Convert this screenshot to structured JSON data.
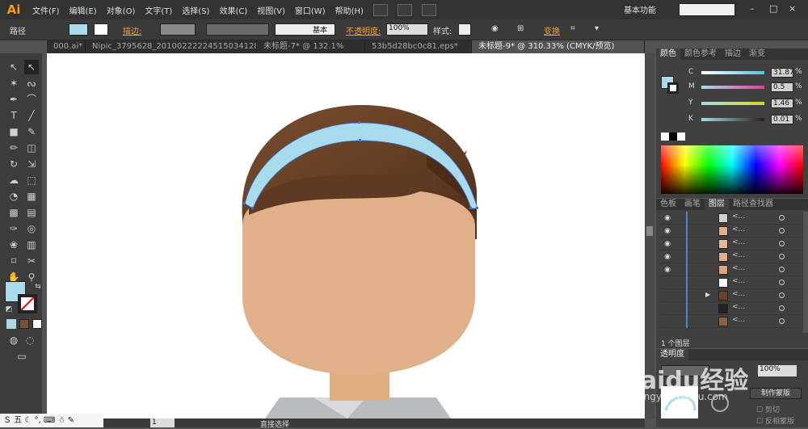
{
  "app": {
    "logo": "Ai",
    "workspace": "基本功能",
    "minimize": "–",
    "restore": "□",
    "close": "×"
  },
  "menu": [
    "文件(F)",
    "编辑(E)",
    "对象(O)",
    "文字(T)",
    "选择(S)",
    "效果(C)",
    "视图(V)",
    "窗口(W)",
    "帮助(H)"
  ],
  "control": {
    "label": "路径",
    "stroke_label": "描边:",
    "stroke_style": "基本",
    "opacity_label": "不透明度:",
    "opacity_value": "100%",
    "style_label": "样式:",
    "transform_label": "变换"
  },
  "tabs": [
    "000.ai*",
    "Nipic_3795628_20100222224515034128.ai*",
    "未标题-7* @ 132.1%",
    "53b5d28bc0c81.eps*",
    "未标题-9* @ 310.33% (CMYK/预览)"
  ],
  "active_tab": 4,
  "color_panel": {
    "tabs": [
      "颜色",
      "颜色参考",
      "描边",
      "渐变"
    ],
    "channels": [
      {
        "name": "C",
        "value": "31.87",
        "gradient": "#4ac8e0"
      },
      {
        "name": "M",
        "value": "0.5",
        "gradient": "#e040a0"
      },
      {
        "name": "Y",
        "value": "1.46",
        "gradient": "#d8d820"
      },
      {
        "name": "K",
        "value": "0.01",
        "gradient": "#202020"
      }
    ],
    "pct": "%",
    "fill_color": "#a8dcec"
  },
  "layers_panel": {
    "tabs": [
      "色板",
      "画笔",
      "图层",
      "路径查找器"
    ],
    "active_tab": 2,
    "rows": [
      {
        "name": "<...",
        "thumb": "#cfcfcf",
        "eye": true
      },
      {
        "name": "<...",
        "thumb": "#e0b088",
        "eye": true
      },
      {
        "name": "<...",
        "thumb": "#e8b890",
        "eye": true
      },
      {
        "name": "<...",
        "thumb": "#e0b088",
        "eye": true
      },
      {
        "name": "<...",
        "thumb": "#dca480",
        "eye": true
      },
      {
        "name": "<...",
        "thumb": "#ffffff",
        "eye": false
      },
      {
        "name": "<...",
        "thumb": "#6b4226",
        "eye": false,
        "expand": true
      },
      {
        "name": "<...",
        "thumb": "#222222",
        "eye": false
      },
      {
        "name": "<...",
        "thumb": "#8a6040",
        "eye": false
      }
    ],
    "footer": "1 个图层"
  },
  "trans_panel": {
    "tab": "透明度",
    "opacity": "100%",
    "make_mask": "制作蒙版",
    "clip": "剪切",
    "invert": "反相蒙版"
  },
  "status": {
    "tool": "直接选择",
    "zoom": "1"
  },
  "watermark": {
    "line1": "Baidu经验",
    "line2": "jingyan.baidu.com"
  },
  "colors": {
    "hair": "#6b4226",
    "skin": "#e0b088",
    "band": "#a8dcec",
    "shirt": "#b8bcc0"
  }
}
